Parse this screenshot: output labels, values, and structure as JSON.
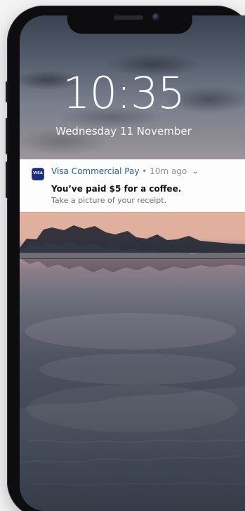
{
  "lock_screen": {
    "time": "10:35",
    "date": "Wednesday 11 November"
  },
  "notification": {
    "app_icon_label": "VISA",
    "app_name": "Visa Commercial Pay",
    "separator": "•",
    "age": "10m ago",
    "expand_icon": "chevron-down-icon",
    "title": "You’ve paid $5 for a coffee.",
    "body": "Take a picture of your receipt."
  },
  "colors": {
    "accent": "#1c56c7",
    "visa_blue": "#1d2d76",
    "device": "#0d0d0f"
  }
}
